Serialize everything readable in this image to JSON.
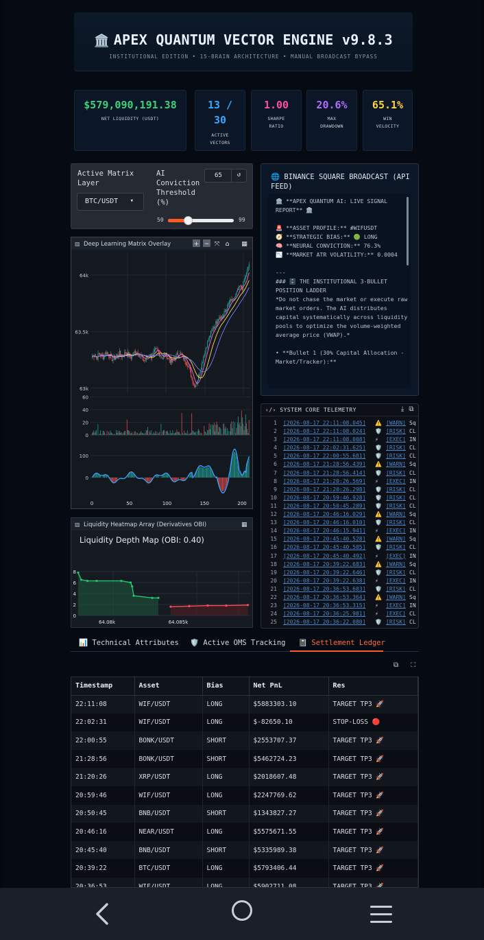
{
  "header": {
    "icon": "🏛️",
    "title": "APEX QUANTUM VECTOR ENGINE v9.8.3",
    "subtitle": "INSTITUTIONAL EDITION • 15-BRAIN ARCHITECTURE • MANUAL BROADCAST BYPASS"
  },
  "metrics": [
    {
      "value": "$579,090,191.38",
      "label": "NET LIQUIDITY (USDT)",
      "color": "#3fd07a"
    },
    {
      "value": "13 / 30",
      "label": "ACTIVE VECTORS",
      "color": "#38a6ff"
    },
    {
      "value": "1.00",
      "label": "SHARPE RATIO",
      "color": "#ff4fa3"
    },
    {
      "value": "20.6%",
      "label": "MAX DRAWDOWN",
      "color": "#b06bff"
    },
    {
      "value": "65.1%",
      "label": "WIN VELOCITY",
      "color": "#ffd23f"
    }
  ],
  "controls": {
    "matrix_label": "Active Matrix Layer",
    "matrix_value": "BTC/USDT",
    "threshold_label": "AI Conviction Threshold (%)",
    "threshold_value": "65",
    "slider_min": "50",
    "slider_max": "99",
    "slider_fraction": 0.306
  },
  "broadcast": {
    "title": "🌐 BINANCE SQUARE BROADCAST (API FEED)",
    "lines": [
      "🏛️ **APEX QUANTUM AI: LIVE SIGNAL REPORT** 🏛️",
      "",
      "🚨 **ASSET PROFILE:** #WIFUSDT",
      "🧭 **STRATEGIC BIAS:** 🟢 LONG",
      "🧠 **NEURAL CONVICTION:** 76.3%",
      "📉 **MARKET ATR VOLATILITY:** 0.0004",
      "",
      "---",
      "### 🗄️ THE INSTITUTIONAL 3-BULLET POSITION LADDER",
      "*Do not chase the market or execute raw market orders. The AI distributes capital systematically across liquidity pools to optimize the volume-weighted average price (VWAP).*",
      "",
      "• **Bullet 1 (30% Capital Allocation - Market/Tracker):**"
    ]
  },
  "matrix_chart": {
    "title": "Deep Learning Matrix Overlay",
    "toolbar": [
      "+",
      "−",
      "⤧",
      "⌂",
      "▦"
    ]
  },
  "chart_data": [
    {
      "type": "line",
      "name": "price",
      "y_ticks": [
        "64k",
        "63.5k",
        "63k"
      ],
      "ylim": [
        62950,
        64200
      ],
      "seed_close": [
        63280,
        63300,
        63260,
        63310,
        63290,
        63270,
        63320,
        63300,
        63280,
        63250,
        63270,
        63290,
        63310,
        63280,
        63300,
        63320,
        63290,
        63270,
        63300,
        63330,
        63310,
        63290,
        63260,
        63240,
        63270,
        63300,
        63280,
        63310,
        63340,
        63320,
        63290,
        63270,
        63300,
        63280,
        63250,
        63230,
        63260,
        63290,
        63310,
        63300,
        63270,
        63240,
        63210,
        63150,
        63080,
        63020,
        63060,
        63120,
        63200,
        63280,
        63360,
        63420,
        63480,
        63520,
        63560,
        63600,
        63640,
        63620,
        63660,
        63700,
        63740,
        63780,
        63760,
        63820,
        63860,
        63900,
        63880,
        63960,
        64020,
        64100
      ]
    },
    {
      "type": "bar",
      "name": "volume",
      "y_ticks": [
        "60",
        "40",
        "20",
        "0"
      ],
      "ylim": [
        0,
        65
      ]
    },
    {
      "type": "line",
      "name": "oscillator",
      "y_ticks": [
        "100",
        "0"
      ],
      "x_ticks": [
        "0",
        "50",
        "100",
        "150",
        "200"
      ],
      "xlim": [
        0,
        210
      ]
    },
    {
      "type": "line",
      "name": "liquidity-depth",
      "title": "Liquidity Depth Map (OBI: 0.40)",
      "y_ticks": [
        "8",
        "6",
        "4",
        "2",
        "0"
      ],
      "x_ticks": [
        "64.08k",
        "64.085k"
      ],
      "bids": [
        [
          0,
          7.8
        ],
        [
          2,
          6.5
        ],
        [
          6,
          6.3
        ],
        [
          12,
          6.3
        ],
        [
          28,
          6.3
        ],
        [
          34,
          6.0
        ],
        [
          35,
          5.3
        ],
        [
          36,
          3.6
        ],
        [
          48,
          3.2
        ],
        [
          52,
          3.2
        ]
      ],
      "asks": [
        [
          60,
          1.6
        ],
        [
          72,
          1.7
        ],
        [
          84,
          1.8
        ],
        [
          96,
          1.8
        ],
        [
          110,
          1.9
        ]
      ]
    }
  ],
  "heatmap": {
    "title": "Liquidity Heatmap Array (Derivatives OBI)"
  },
  "telemetry": {
    "title": "SYSTEM CORE TELEMETRY",
    "rows": [
      {
        "n": "1",
        "ts": "[2026-08-17 22:11:08.045]",
        "ic": "⚠️",
        "tag": "[WARN]",
        "tx": "Sq"
      },
      {
        "n": "2",
        "ts": "[2026-08-17 22:11:08.024]",
        "ic": "🛡️",
        "tag": "[RISK]",
        "tx": "CL"
      },
      {
        "n": "3",
        "ts": "[2026-08-17 22:11:08.008]",
        "ic": "⚡",
        "tag": "[EXEC]",
        "tx": "IN"
      },
      {
        "n": "4",
        "ts": "[2026-08-17 22:02:31.625]",
        "ic": "🛡️",
        "tag": "[RISK]",
        "tx": "CL"
      },
      {
        "n": "5",
        "ts": "[2026-08-17 22:00:55.681]",
        "ic": "🛡️",
        "tag": "[RISK]",
        "tx": "CL"
      },
      {
        "n": "6",
        "ts": "[2026-08-17 21:28:56.439]",
        "ic": "⚠️",
        "tag": "[WARN]",
        "tx": "Sq"
      },
      {
        "n": "7",
        "ts": "[2026-08-17 21:28:56.414]",
        "ic": "🛡️",
        "tag": "[RISK]",
        "tx": "CL"
      },
      {
        "n": "8",
        "ts": "[2026-08-17 21:20:26.569]",
        "ic": "⚡",
        "tag": "[EXEC]",
        "tx": "IN"
      },
      {
        "n": "9",
        "ts": "[2026-08-17 21:20:26.298]",
        "ic": "🛡️",
        "tag": "[RISK]",
        "tx": "CL"
      },
      {
        "n": "10",
        "ts": "[2026-08-17 20:59:46.928]",
        "ic": "🛡️",
        "tag": "[RISK]",
        "tx": "CL"
      },
      {
        "n": "11",
        "ts": "[2026-08-17 20:50:45.289]",
        "ic": "🛡️",
        "tag": "[RISK]",
        "tx": "CL"
      },
      {
        "n": "12",
        "ts": "[2026-08-17 20:46:16.029]",
        "ic": "⚠️",
        "tag": "[WARN]",
        "tx": "Sq"
      },
      {
        "n": "13",
        "ts": "[2026-08-17 20:46:16.010]",
        "ic": "🛡️",
        "tag": "[RISK]",
        "tx": "CL"
      },
      {
        "n": "14",
        "ts": "[2026-08-17 20:46:15.941]",
        "ic": "⚡",
        "tag": "[EXEC]",
        "tx": "IN"
      },
      {
        "n": "15",
        "ts": "[2026-08-17 20:45:40.528]",
        "ic": "⚠️",
        "tag": "[WARN]",
        "tx": "Sq"
      },
      {
        "n": "16",
        "ts": "[2026-08-17 20:45:40.505]",
        "ic": "🛡️",
        "tag": "[RISK]",
        "tx": "CL"
      },
      {
        "n": "17",
        "ts": "[2026-08-17 20:45:40.492]",
        "ic": "⚡",
        "tag": "[EXEC]",
        "tx": "IN"
      },
      {
        "n": "18",
        "ts": "[2026-08-17 20:39:22.683]",
        "ic": "⚠️",
        "tag": "[WARN]",
        "tx": "Sq"
      },
      {
        "n": "19",
        "ts": "[2026-08-17 20:39:22.646]",
        "ic": "🛡️",
        "tag": "[RISK]",
        "tx": "CL"
      },
      {
        "n": "20",
        "ts": "[2026-08-17 20:39:22.638]",
        "ic": "⚡",
        "tag": "[EXEC]",
        "tx": "IN"
      },
      {
        "n": "21",
        "ts": "[2026-08-17 20:36:53.603]",
        "ic": "🛡️",
        "tag": "[RISK]",
        "tx": "CL"
      },
      {
        "n": "22",
        "ts": "[2026-08-17 20:36:53.364]",
        "ic": "⚠️",
        "tag": "[WARN]",
        "tx": "Sq"
      },
      {
        "n": "23",
        "ts": "[2026-08-17 20:36:53.315]",
        "ic": "⚡",
        "tag": "[EXEC]",
        "tx": "IN"
      },
      {
        "n": "24",
        "ts": "[2026-08-17 20:36:25.981]",
        "ic": "⚡",
        "tag": "[EXEC]",
        "tx": "CL"
      },
      {
        "n": "25",
        "ts": "[2026-08-17 20:36:22.080]",
        "ic": "🛡️",
        "tag": "[RISK]",
        "tx": "CL"
      }
    ]
  },
  "tabs": [
    {
      "label": "📊 Technical Attributes",
      "active": false
    },
    {
      "label": "🛡️ Active OMS Tracking",
      "active": false
    },
    {
      "label": "📓 Settlement Ledger",
      "active": true
    }
  ],
  "table_tools": [
    "⧉",
    "⛶"
  ],
  "ledger": {
    "columns": [
      "Timestamp",
      "Asset",
      "Bias",
      "Net PnL",
      "Res"
    ],
    "rows": [
      [
        "22:11:08",
        "WIF/USDT",
        "LONG",
        "$5883303.10",
        "TARGET TP3 🚀"
      ],
      [
        "22:02:31",
        "WIF/USDT",
        "LONG",
        "$-82650.10",
        "STOP-LOSS 🔴"
      ],
      [
        "22:00:55",
        "BONK/USDT",
        "SHORT",
        "$2553707.37",
        "TARGET TP3 🚀"
      ],
      [
        "21:28:56",
        "BONK/USDT",
        "SHORT",
        "$5462724.23",
        "TARGET TP3 🚀"
      ],
      [
        "21:20:26",
        "XRP/USDT",
        "LONG",
        "$2018607.48",
        "TARGET TP3 🚀"
      ],
      [
        "20:59:46",
        "WIF/USDT",
        "LONG",
        "$2247769.62",
        "TARGET TP3 🚀"
      ],
      [
        "20:50:45",
        "BNB/USDT",
        "SHORT",
        "$1343827.27",
        "TARGET TP3 🚀"
      ],
      [
        "20:46:16",
        "NEAR/USDT",
        "LONG",
        "$5575671.55",
        "TARGET TP3 🚀"
      ],
      [
        "20:45:40",
        "BNB/USDT",
        "SHORT",
        "$5335989.38",
        "TARGET TP3 🚀"
      ],
      [
        "20:39:22",
        "BTC/USDT",
        "LONG",
        "$5793406.44",
        "TARGET TP3 🚀"
      ],
      [
        "20:36:53",
        "WIF/USDT",
        "LONG",
        "$5902711.08",
        "TARGET TP3 🚀"
      ]
    ]
  }
}
